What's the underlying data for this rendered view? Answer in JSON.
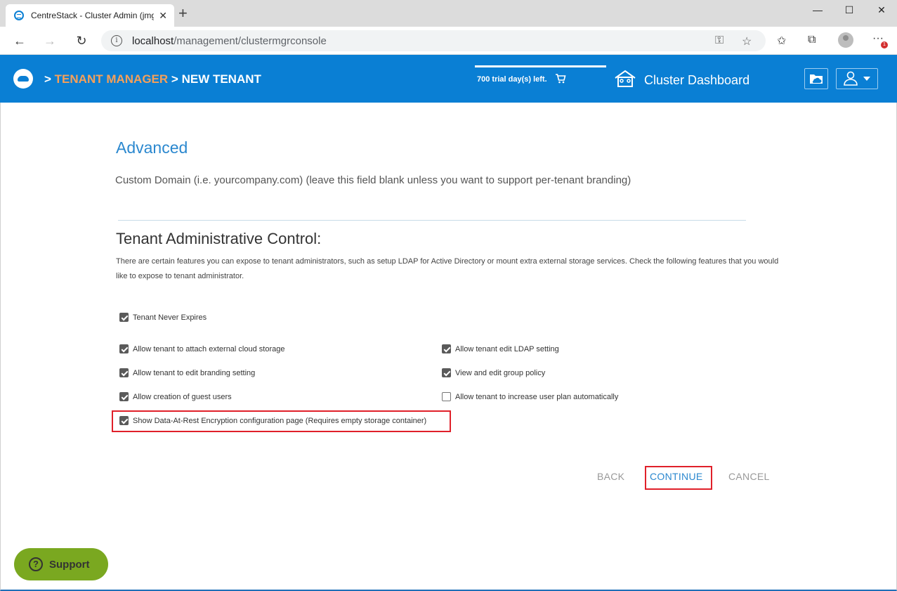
{
  "browser": {
    "tab_title": "CentreStack - Cluster Admin (jmg",
    "tab_close": "✕",
    "new_tab": "+",
    "minimize": "—",
    "maximize": "☐",
    "close": "✕",
    "back": "←",
    "forward": "→",
    "refresh": "↻",
    "url_info": "i",
    "url_host": "localhost",
    "url_path": "/management/clustermgrconsole",
    "key_icon": "⚿",
    "star_icon": "☆",
    "favorites_icon": "✩",
    "collections_icon": "⧉",
    "more_icon": "···",
    "notif_count": "1"
  },
  "header": {
    "sep1": ">",
    "tenant_manager": "TENANT MANAGER",
    "sep2": ">",
    "new_tenant": "NEW TENANT",
    "trial_text": "700 trial day(s) left.",
    "cart": "🛒",
    "dashboard_label": "Cluster Dashboard"
  },
  "main": {
    "advanced_title": "Advanced",
    "custom_domain_text": "Custom Domain (i.e. yourcompany.com) (leave this field blank unless you want to support per-tenant branding)",
    "tac_title": "Tenant Administrative Control:",
    "tac_desc": "There are certain features you can expose to tenant administrators, such as setup LDAP for Active Directory or mount extra external storage services. Check the following features that you would like to expose to tenant administrator.",
    "options": {
      "never_expires": {
        "label": "Tenant Never Expires",
        "checked": true
      },
      "attach_storage": {
        "label": "Allow tenant to attach external cloud storage",
        "checked": true
      },
      "edit_ldap": {
        "label": "Allow tenant edit LDAP setting",
        "checked": true
      },
      "edit_branding": {
        "label": "Allow tenant to edit branding setting",
        "checked": true
      },
      "group_policy": {
        "label": "View and edit group policy",
        "checked": true
      },
      "guest_users": {
        "label": "Allow creation of guest users",
        "checked": true
      },
      "increase_plan": {
        "label": "Allow tenant to increase user plan automatically",
        "checked": false
      },
      "data_at_rest": {
        "label": "Show Data-At-Rest Encryption configuration page (Requires empty storage container)",
        "checked": true
      }
    },
    "back_label": "BACK",
    "continue_label": "CONTINUE",
    "cancel_label": "CANCEL"
  },
  "support": {
    "icon": "?",
    "label": "Support"
  }
}
